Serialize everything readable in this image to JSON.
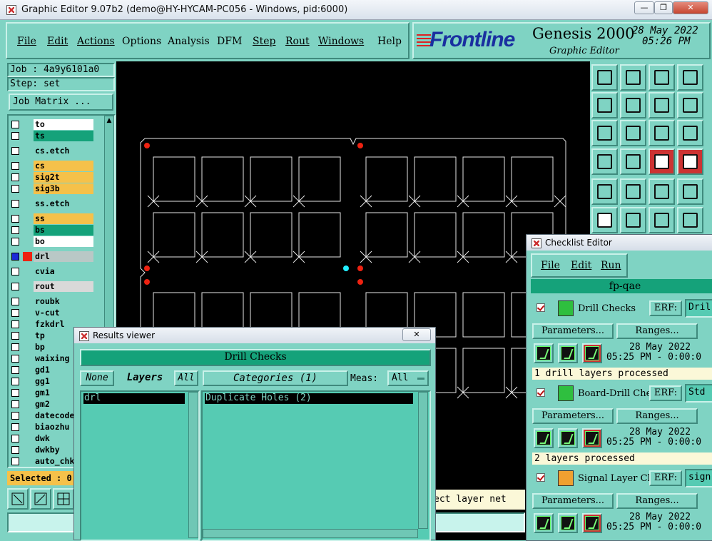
{
  "window": {
    "title": "Graphic Editor 9.07b2 (demo@HY-HYCAM-PC056 - Windows, pid:6000)",
    "minimize": "—",
    "restore": "❐",
    "close": "✕"
  },
  "menu": [
    "File",
    "Edit",
    "Actions",
    "Options",
    "Analysis",
    "DFM",
    "Step",
    "Rout",
    "Windows",
    "Help"
  ],
  "logo": {
    "brand": "Frontline",
    "product": "Genesis 2000",
    "subtitle": "Graphic Editor",
    "date": "28 May 2022",
    "time": "05:26 PM"
  },
  "job": {
    "job_label": "Job : 4a9y6101a0",
    "step_label": "Step: set",
    "matrix_button": "Job Matrix ..."
  },
  "layers": [
    {
      "name": "to",
      "color": "#ffffff"
    },
    {
      "name": "ts",
      "color": "#15a27a"
    },
    {
      "name": "cs.etch",
      "color": "#7fd3c3"
    },
    {
      "name": "cs",
      "color": "#f5c14a"
    },
    {
      "name": "sig2t",
      "color": "#f5c14a"
    },
    {
      "name": "sig3b",
      "color": "#f5c14a"
    },
    {
      "name": "ss.etch",
      "color": "#7fd3c3"
    },
    {
      "name": "ss",
      "color": "#f5c14a"
    },
    {
      "name": "bs",
      "color": "#15a27a"
    },
    {
      "name": "bo",
      "color": "#ffffff"
    },
    {
      "name": "drl",
      "color": "#b9c8c6"
    },
    {
      "name": "cvia",
      "color": "#7fd3c3"
    },
    {
      "name": "rout",
      "color": "#d9d9d9"
    },
    {
      "name": "roubk",
      "color": "#7fd3c3"
    },
    {
      "name": "v-cut",
      "color": "#7fd3c3"
    },
    {
      "name": "fzkdrl",
      "color": "#7fd3c3"
    },
    {
      "name": "tp",
      "color": "#7fd3c3"
    },
    {
      "name": "bp",
      "color": "#7fd3c3"
    },
    {
      "name": "waixing",
      "color": "#7fd3c3"
    },
    {
      "name": "gd1",
      "color": "#7fd3c3"
    },
    {
      "name": "gg1",
      "color": "#7fd3c3"
    },
    {
      "name": "gm1",
      "color": "#7fd3c3"
    },
    {
      "name": "gm2",
      "color": "#7fd3c3"
    },
    {
      "name": "datecode",
      "color": "#7fd3c3"
    },
    {
      "name": "biaozhu",
      "color": "#7fd3c3"
    },
    {
      "name": "dwk",
      "color": "#7fd3c3"
    },
    {
      "name": "dwkby",
      "color": "#7fd3c3"
    },
    {
      "name": "auto_chk",
      "color": "#7fd3c3"
    }
  ],
  "selected": "Selected : 0",
  "prompt": "ect layer net",
  "results_viewer": {
    "title": "Results viewer",
    "header": "Drill Checks",
    "none_btn": "None",
    "layers_label": "Layers",
    "all_btn": "All",
    "categories_label": "Categories (1)",
    "meas_label": "Meas:",
    "meas_value": "All",
    "layer_items": [
      "drl"
    ],
    "category_items": [
      "Duplicate Holes (2)"
    ]
  },
  "checklist": {
    "title": "Checklist Editor",
    "menu": [
      "File",
      "Edit",
      "Run"
    ],
    "name": "fp-qae",
    "erf_label": "ERF:",
    "params_btn": "Parameters...",
    "ranges_btn": "Ranges...",
    "items": [
      {
        "name": "Drill Checks",
        "erf": "Dril",
        "date": "28 May 2022",
        "time": "05:25 PM - 0:00:0",
        "status": "1 drill layers processed"
      },
      {
        "name": "Board-Drill Che",
        "erf": "Std",
        "date": "28 May 2022",
        "time": "05:25 PM - 0:00:0",
        "status": "2 layers processed"
      },
      {
        "name": "Signal Layer Ch",
        "erf": "sign",
        "date": "28 May 2022",
        "time": "05:25 PM - 0:00:0",
        "status": ""
      }
    ]
  },
  "colors": {
    "bg": "#7fd3c3",
    "canvas": "#000000",
    "highlight": "#15a27a",
    "orange": "#f5c14a",
    "status_yellow": "#fbf8d8"
  }
}
